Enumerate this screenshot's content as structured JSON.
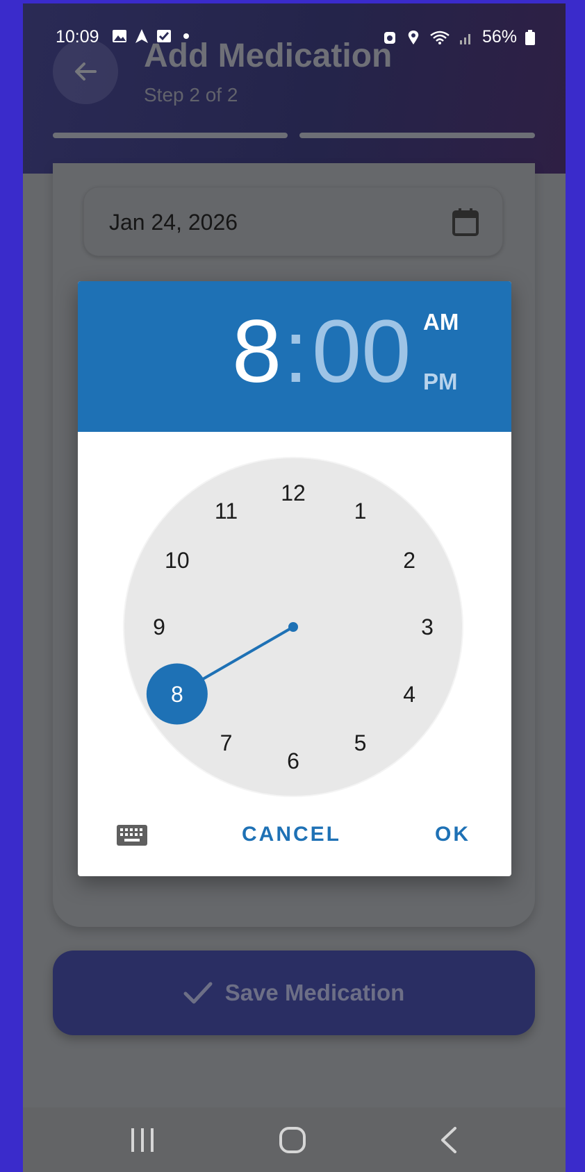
{
  "status_bar": {
    "time": "10:09",
    "battery": "56%"
  },
  "header": {
    "title": "Add Medication",
    "subtitle": "Step 2 of 2"
  },
  "form": {
    "date_value": "Jan 24, 2026"
  },
  "time_picker": {
    "hour": "8",
    "separator": ":",
    "minute": "00",
    "am_label": "AM",
    "pm_label": "PM",
    "selected_period": "AM",
    "selected_hour": 8,
    "clock_numbers": [
      "12",
      "1",
      "2",
      "3",
      "4",
      "5",
      "6",
      "7",
      "8",
      "9",
      "10",
      "11"
    ],
    "cancel_label": "CANCEL",
    "ok_label": "OK"
  },
  "save_button": {
    "label": "Save Medication"
  },
  "colors": {
    "accent": "#1e71b5",
    "save_button": "#2a2e63",
    "background": "#3a2bcb"
  },
  "icons": {
    "back": "arrow-left-icon",
    "calendar": "calendar-icon",
    "keyboard": "keyboard-icon",
    "check": "check-icon",
    "nav_recent": "recent-apps-icon",
    "nav_home": "home-icon",
    "nav_back": "chevron-left-icon"
  }
}
